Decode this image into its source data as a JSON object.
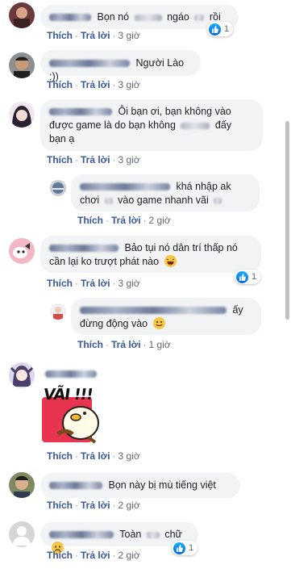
{
  "actions": {
    "like": "Thích",
    "reply": "Trả lời",
    "dot": "·"
  },
  "comments": [
    {
      "text_a": "Bọn nó",
      "text_b": "ngáo",
      "text_c": "rồi",
      "time": "3 giờ",
      "reactions": "1"
    },
    {
      "text_a": "Người Lào :))",
      "time": "3 giờ"
    },
    {
      "line1_a": "Ôi bạn ơi, bạn không vào",
      "line2_a": "được game là do bạn không",
      "line2_b": "đấy",
      "line3": "bạn ạ",
      "time": "3 giờ"
    },
    {
      "line1_a": "khá nhập ak",
      "line2_a": "chơi",
      "line2_b": "vào game nhanh vãi",
      "time": "2 giờ"
    },
    {
      "line1_a": "Bảo tụi nó dân trí thấp nó",
      "line2_a": "cần lại ko trượt phát nào",
      "time": "3 giờ",
      "reactions": "1"
    },
    {
      "line1_a": "ấy",
      "line2_a": "đừng động vào",
      "time": "1 giờ"
    },
    {
      "sticker_text": "VÃI !!!",
      "time": "3 giờ"
    },
    {
      "text_a": "Bọn này bị mù tiếng việt",
      "time": "2 giờ"
    },
    {
      "text_a": "Toàn",
      "text_b": "chữ",
      "time": "2 giờ",
      "reactions": "1"
    }
  ],
  "colors": {
    "link": "#385898",
    "bubble": "#f2f3f5",
    "like": "#1877f2"
  },
  "icons": {
    "like": "like-icon",
    "laugh": "laughing-emoji-icon",
    "smile": "smile-emoji-icon",
    "sad": "sad-emoji-icon"
  }
}
